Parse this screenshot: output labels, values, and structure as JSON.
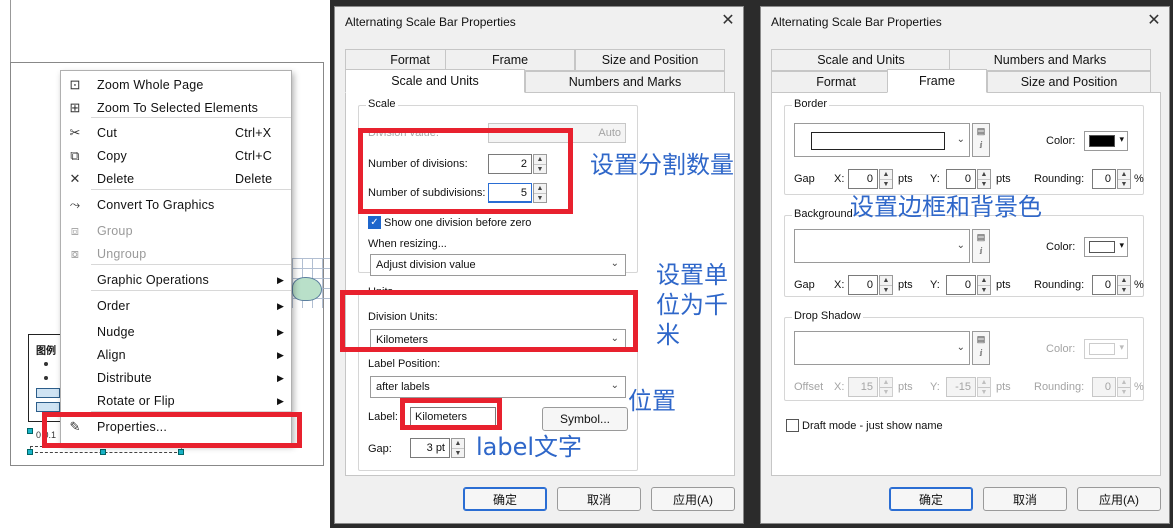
{
  "left_panel": {
    "legend_title": "图例",
    "scalebar_text": "0 0.1",
    "context_menu": {
      "items": [
        {
          "icon": "zoom-whole-page-icon",
          "glyph": "⊡",
          "label": "Zoom Whole Page",
          "shortcut": "",
          "submenu": false,
          "disabled": false
        },
        {
          "icon": "zoom-selected-icon",
          "glyph": "⊞",
          "label": "Zoom To Selected Elements",
          "shortcut": "",
          "submenu": false,
          "disabled": false
        },
        {
          "icon": "cut-icon",
          "glyph": "✂",
          "label": "Cut",
          "shortcut": "Ctrl+X",
          "submenu": false,
          "disabled": false
        },
        {
          "icon": "copy-icon",
          "glyph": "⧉",
          "label": "Copy",
          "shortcut": "Ctrl+C",
          "submenu": false,
          "disabled": false
        },
        {
          "icon": "delete-icon",
          "glyph": "✕",
          "label": "Delete",
          "shortcut": "Delete",
          "submenu": false,
          "disabled": false
        },
        {
          "icon": "convert-graphics-icon",
          "glyph": "⤳",
          "label": "Convert To Graphics",
          "shortcut": "",
          "submenu": false,
          "disabled": false
        },
        {
          "icon": "group-icon",
          "glyph": "⧈",
          "label": "Group",
          "shortcut": "",
          "submenu": false,
          "disabled": true
        },
        {
          "icon": "ungroup-icon",
          "glyph": "⧇",
          "label": "Ungroup",
          "shortcut": "",
          "submenu": false,
          "disabled": true
        },
        {
          "icon": "",
          "glyph": "",
          "label": "Graphic Operations",
          "shortcut": "",
          "submenu": true,
          "disabled": false
        },
        {
          "icon": "",
          "glyph": "",
          "label": "Order",
          "shortcut": "",
          "submenu": true,
          "disabled": false
        },
        {
          "icon": "",
          "glyph": "",
          "label": "Nudge",
          "shortcut": "",
          "submenu": true,
          "disabled": false
        },
        {
          "icon": "",
          "glyph": "",
          "label": "Align",
          "shortcut": "",
          "submenu": true,
          "disabled": false
        },
        {
          "icon": "",
          "glyph": "",
          "label": "Distribute",
          "shortcut": "",
          "submenu": true,
          "disabled": false
        },
        {
          "icon": "",
          "glyph": "",
          "label": "Rotate or Flip",
          "shortcut": "",
          "submenu": true,
          "disabled": false
        },
        {
          "icon": "properties-icon",
          "glyph": "✎",
          "label": "Properties...",
          "shortcut": "",
          "submenu": false,
          "disabled": false
        }
      ]
    }
  },
  "dialog1": {
    "title": "Alternating Scale Bar Properties",
    "tabs_back": [
      "Format",
      "Frame",
      "Size and Position"
    ],
    "tabs_front": [
      "Scale and Units",
      "Numbers and Marks"
    ],
    "scale_group": "Scale",
    "division_value_label": "Division value:",
    "division_value": "Auto",
    "num_divisions_label": "Number of divisions:",
    "num_divisions": "2",
    "num_subdivisions_label": "Number of subdivisions:",
    "num_subdivisions": "5",
    "show_one_division": "Show one division before zero",
    "when_resizing_label": "When resizing...",
    "when_resizing": "Adjust division value",
    "units_group": "Units",
    "division_units_label": "Division Units:",
    "division_units": "Kilometers",
    "label_position_label": "Label Position:",
    "label_position": "after labels",
    "label_label": "Label:",
    "label_value": "Kilometers",
    "symbol_button": "Symbol...",
    "gap_label": "Gap:",
    "gap_value": "3 pt",
    "ok": "确定",
    "cancel": "取消",
    "apply": "应用(A)"
  },
  "dialog2": {
    "title": "Alternating Scale Bar Properties",
    "tabs_back": [
      "Scale and Units",
      "Numbers and Marks"
    ],
    "tabs_front": [
      "Format",
      "Frame",
      "Size and Position"
    ],
    "border_group": "Border",
    "background_group": "Background",
    "shadow_group": "Drop Shadow",
    "color_label": "Color:",
    "gap_label": "Gap",
    "x_label": "X:",
    "y_label": "Y:",
    "pts": "pts",
    "rounding_label": "Rounding:",
    "percent": "%",
    "zero": "0",
    "offset_label": "Offset",
    "shadow_x": "15",
    "shadow_y": "-15",
    "draft_mode": "Draft mode - just show name",
    "border_color": "#000000",
    "background_color": "#ffffff",
    "ok": "确定",
    "cancel": "取消",
    "apply": "应用(A)"
  },
  "annotations": {
    "divisions": "设置分割数量",
    "units": "设置单位为千米",
    "position": "位置",
    "label_text": "label文字",
    "frame": "设置边框和背景色"
  }
}
